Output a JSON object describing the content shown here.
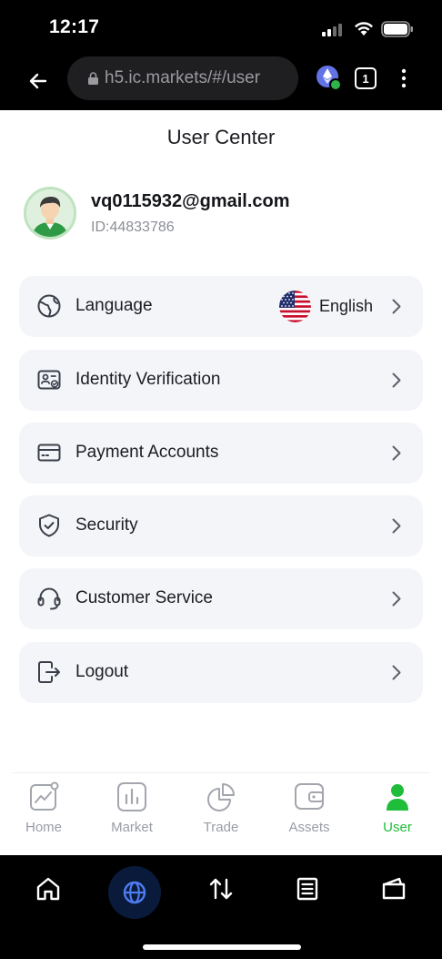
{
  "status_bar": {
    "time": "12:17"
  },
  "browser": {
    "url": "h5.ic.markets/#/user",
    "tab_count": "1"
  },
  "page": {
    "title": "User Center"
  },
  "user": {
    "email": "vq0115932@gmail.com",
    "id": "ID:44833786"
  },
  "menu": {
    "items": [
      {
        "label": "Language",
        "icon": "globe-icon",
        "value": "English",
        "flag": "us-flag-icon"
      },
      {
        "label": "Identity Verification",
        "icon": "id-card-icon"
      },
      {
        "label": "Payment Accounts",
        "icon": "credit-card-icon"
      },
      {
        "label": "Security",
        "icon": "shield-check-icon"
      },
      {
        "label": "Customer Service",
        "icon": "headset-icon"
      },
      {
        "label": "Logout",
        "icon": "logout-icon"
      }
    ]
  },
  "nav": {
    "items": [
      {
        "label": "Home",
        "icon": "home-chart-icon"
      },
      {
        "label": "Market",
        "icon": "bar-chart-icon"
      },
      {
        "label": "Trade",
        "icon": "pie-chart-icon"
      },
      {
        "label": "Assets",
        "icon": "wallet-icon"
      },
      {
        "label": "User",
        "icon": "user-icon"
      }
    ],
    "active": "User"
  },
  "colors": {
    "accent": "#1fbd3a",
    "menu_bg": "#f4f5f9",
    "icon": "#3b3f4a",
    "text": "#1c1d22",
    "muted": "#8c8e96"
  }
}
